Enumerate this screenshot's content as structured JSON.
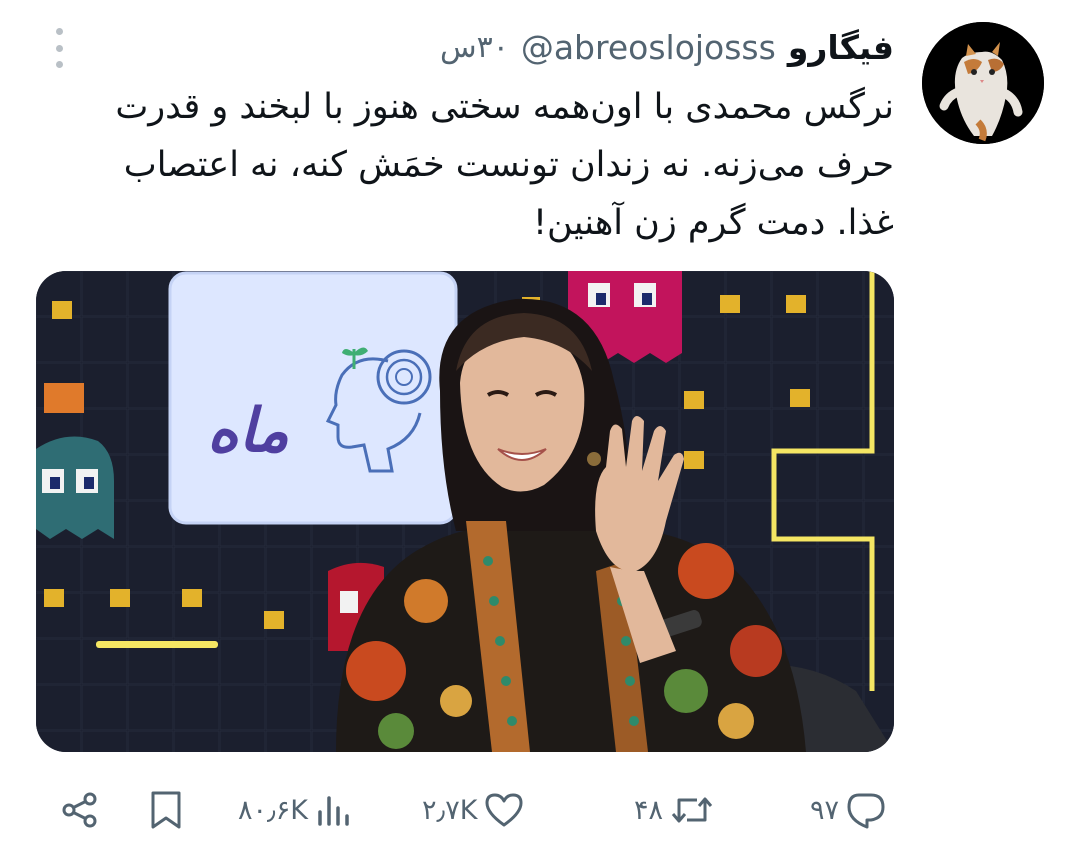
{
  "tweet": {
    "display_name": "فیگارو",
    "handle": "@abreoslojosss",
    "time": "۳۰س",
    "text_lines": [
      "نرگس محمدی با اون‌همه سختی هنوز با لبخند و قدرت",
      "حرف می‌زنه. نه زندان تونست خمَش کنه، نه اعتصاب",
      "غذا. دمت گرم زن آهنین!"
    ]
  },
  "media": {
    "screen_logo_text": "ماه",
    "accent_colors": {
      "background": "#1b1f2e",
      "neon_yellow": "#f5e663",
      "ghost_magenta": "#c2145c",
      "ghost_teal": "#2f6d74",
      "screen_panel": "#d8e4ff",
      "logo_purple": "#4f3fa0"
    }
  },
  "actions": {
    "replies": "۹۷",
    "retweets": "۴۸",
    "likes": "۲٫۷K",
    "views": "۸۰٫۶K"
  },
  "icons": {
    "more": "more-vertical-icon",
    "share": "share-icon",
    "bookmark": "bookmark-icon",
    "views": "views-icon",
    "like": "heart-icon",
    "retweet": "retweet-icon",
    "reply": "reply-icon"
  },
  "colors": {
    "text_primary": "#0f1419",
    "text_secondary": "#536471"
  }
}
